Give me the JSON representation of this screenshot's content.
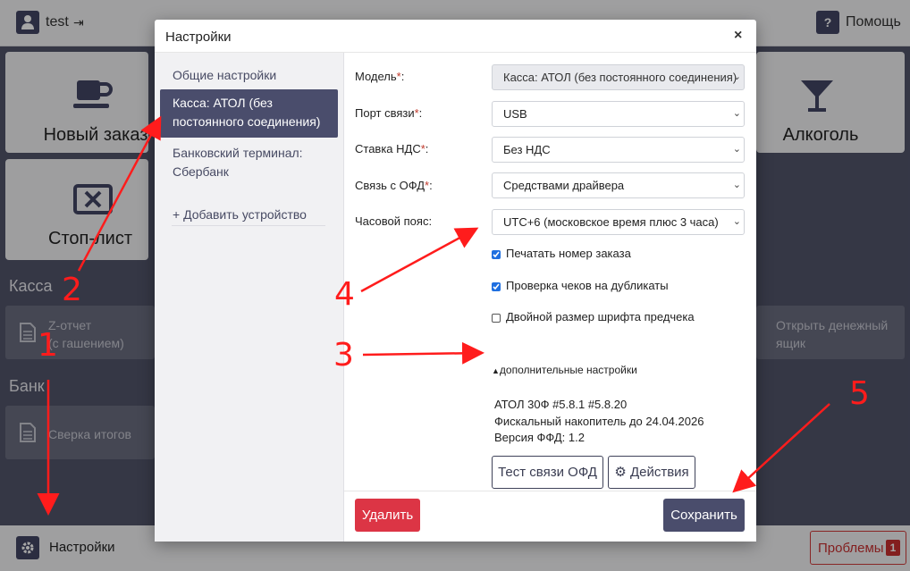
{
  "header": {
    "user_name": "test",
    "help_label": "Помощь"
  },
  "tiles": {
    "new_order": "Новый заказ",
    "alcohol": "Алкоголь",
    "stop_list": "Стоп-лист"
  },
  "sections": {
    "kassa": "Касса",
    "bank": "Банк",
    "z_report": "Z-отчет\n(с гашением)",
    "open_drawer": "Открыть денежный\nящик",
    "reconciliation": "Сверка итогов"
  },
  "footer": {
    "settings_label": "Настройки",
    "problems_label": "Проблемы",
    "problems_count": "1"
  },
  "modal": {
    "title": "Настройки",
    "close": "×",
    "sidebar": {
      "general": "Общие настройки",
      "kassa": "Касса: АТОЛ (без постоянного соединения)",
      "bank_terminal": "Банковский терминал: Сбербанк",
      "add_device": "+ Добавить устройство"
    },
    "form": {
      "model_label": "Модель",
      "model_value": "Касса: АТОЛ (без постоянного соединения)",
      "port_label": "Порт связи",
      "port_value": "USB",
      "vat_label": "Ставка НДС",
      "vat_value": "Без НДС",
      "ofd_label": "Связь с ОФД",
      "ofd_value": "Средствами драйвера",
      "tz_label": "Часовой пояс:",
      "tz_value": "UTC+6 (московское время плюс 3 часа)",
      "required_mark": "*",
      "colon": ":",
      "print_order_label": "Печатать номер заказа",
      "print_order_checked": true,
      "check_dup_label": "Проверка чеков на дубликаты",
      "check_dup_checked": true,
      "double_font_label": "Двойной размер шрифта предчека",
      "double_font_checked": false,
      "advanced_toggle": "дополнительные настройки",
      "info_model": "АТОЛ 30Ф #5.8.1 #5.8.20",
      "info_fn": "Фискальный накопитель до 24.04.2026",
      "info_ffd": "Версия ФФД: 1.2",
      "test_ofd_button": "Тест связи ОФД",
      "actions_button": "Действия"
    },
    "footer": {
      "delete_button": "Удалить",
      "save_button": "Сохранить"
    }
  },
  "annotations": [
    "1",
    "2",
    "3",
    "4",
    "5"
  ],
  "colors": {
    "accent": "#4a4d6c",
    "danger": "#dc3545",
    "annotation": "#ff1c1c",
    "backdrop": "#52556b"
  }
}
